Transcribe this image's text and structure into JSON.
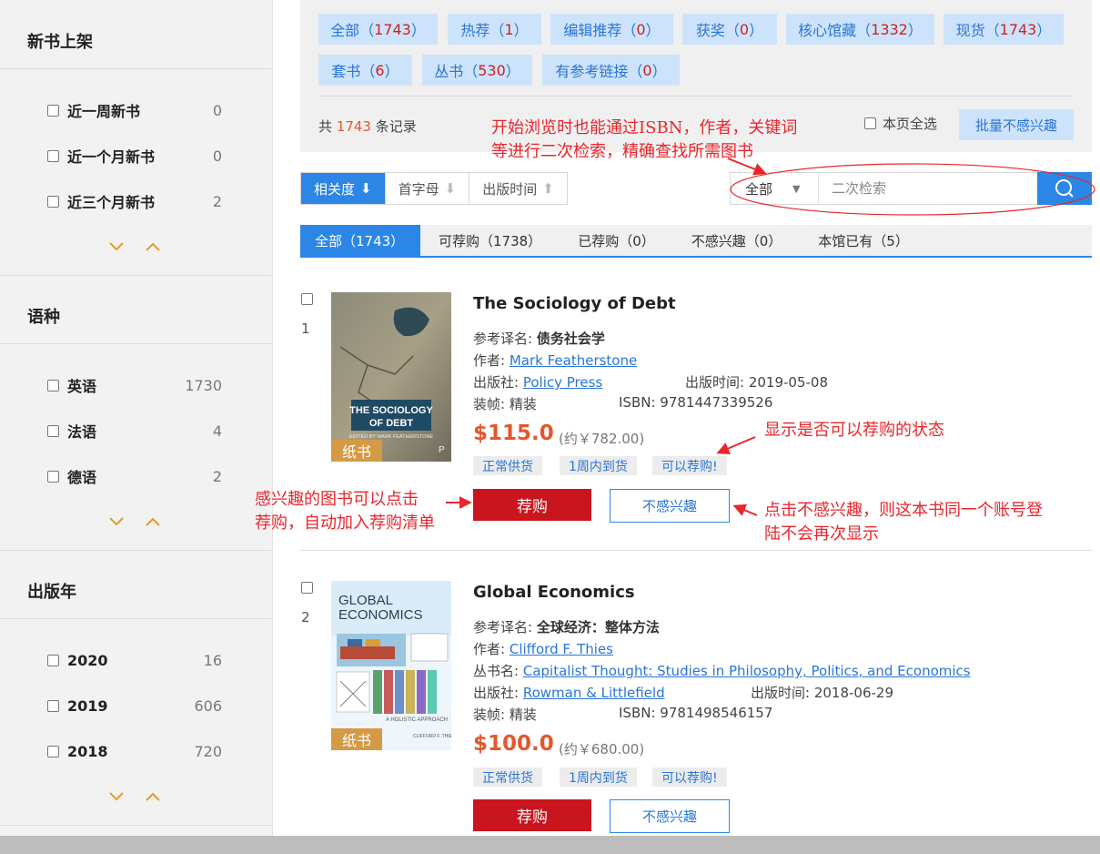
{
  "sidebar": {
    "sections": [
      {
        "title": "新书上架",
        "items": [
          {
            "label": "近一周新书",
            "count": "0"
          },
          {
            "label": "近一个月新书",
            "count": "0"
          },
          {
            "label": "近三个月新书",
            "count": "2"
          }
        ]
      },
      {
        "title": "语种",
        "items": [
          {
            "label": "英语",
            "count": "1730"
          },
          {
            "label": "法语",
            "count": "4"
          },
          {
            "label": "德语",
            "count": "2"
          }
        ]
      },
      {
        "title": "出版年",
        "items": [
          {
            "label": "2020",
            "count": "16"
          },
          {
            "label": "2019",
            "count": "606"
          },
          {
            "label": "2018",
            "count": "720"
          }
        ]
      }
    ]
  },
  "categories": [
    {
      "label": "全部",
      "count": "1743"
    },
    {
      "label": "热荐",
      "count": "1"
    },
    {
      "label": "编辑推荐",
      "count": "0"
    },
    {
      "label": "获奖",
      "count": "0"
    },
    {
      "label": "核心馆藏",
      "count": "1332"
    },
    {
      "label": "现货",
      "count": "1743"
    },
    {
      "label": "套书",
      "count": "6"
    },
    {
      "label": "丛书",
      "count": "530"
    },
    {
      "label": "有参考链接",
      "count": "0"
    }
  ],
  "summary": {
    "prefix": "共",
    "count": "1743",
    "suffix": "条记录",
    "select_page": "本页全选",
    "batch": "批量不感兴趣"
  },
  "sort": {
    "items": [
      "相关度",
      "首字母",
      "出版时间"
    ]
  },
  "search": {
    "scope": "全部",
    "placeholder": "二次检索"
  },
  "tabs": [
    "全部（1743）",
    "可荐购（1738）",
    "已荐购（0）",
    "不感兴趣（0）",
    "本馆已有（5）"
  ],
  "books": [
    {
      "index": "1",
      "title": "The Sociology of Debt",
      "cover_title": "THE SOCIOLOGY OF DEBT",
      "cover_sub": "EDITED BY MARK FEATHERSTONE",
      "tag": "纸书",
      "trans_label": "参考译名:",
      "trans": "债务社会学",
      "author_label": "作者:",
      "author": "Mark Featherstone",
      "publisher_label": "出版社:",
      "publisher": "Policy Press",
      "pubdate_label": "出版时间:",
      "pubdate": "2019-05-08",
      "binding_label": "装帧:",
      "binding": "精装",
      "isbn_label": "ISBN:",
      "isbn": "9781447339526",
      "price": "$115.0",
      "approx": "(约￥782.00)",
      "status": [
        "正常供货",
        "1周内到货",
        "可以荐购!"
      ],
      "recommend": "荐购",
      "not_interested": "不感兴趣"
    },
    {
      "index": "2",
      "title": "Global Economics",
      "cover_title": "GLOBAL ECONOMICS",
      "cover_sub": "A HOLISTIC APPROACH",
      "cover_author": "CLIFFORD F. THIES",
      "tag": "纸书",
      "trans_label": "参考译名:",
      "trans": "全球经济：整体方法",
      "author_label": "作者:",
      "author": "Clifford F. Thies",
      "series_label": "丛书名:",
      "series": "Capitalist Thought: Studies in Philosophy, Politics, and Economics",
      "publisher_label": "出版社:",
      "publisher": "Rowman & Littlefield",
      "pubdate_label": "出版时间:",
      "pubdate": "2018-06-29",
      "binding_label": "装帧:",
      "binding": "精装",
      "isbn_label": "ISBN:",
      "isbn": "9781498546157",
      "price": "$100.0",
      "approx": "(约￥680.00)",
      "status": [
        "正常供货",
        "1周内到货",
        "可以荐购!"
      ],
      "recommend": "荐购",
      "not_interested": "不感兴趣"
    }
  ],
  "annotations": {
    "search_tip": [
      "开始浏览时也能通过ISBN，作者，关键词",
      "等进行二次检索，精确查找所需图书"
    ],
    "status_tip": "显示是否可以荐购的状态",
    "recommend_tip": [
      "感兴趣的图书可以点击",
      "荐购，自动加入荐购清单"
    ],
    "noint_tip": [
      "点击不感兴趣，则这本书同一个账号登",
      "陆不会再次显示"
    ]
  },
  "colors": {
    "accent": "#2b86e6",
    "recommend": "#c9151e",
    "price": "#e4572e",
    "annotation": "#e8262c",
    "book_tag": "#d59a45"
  }
}
